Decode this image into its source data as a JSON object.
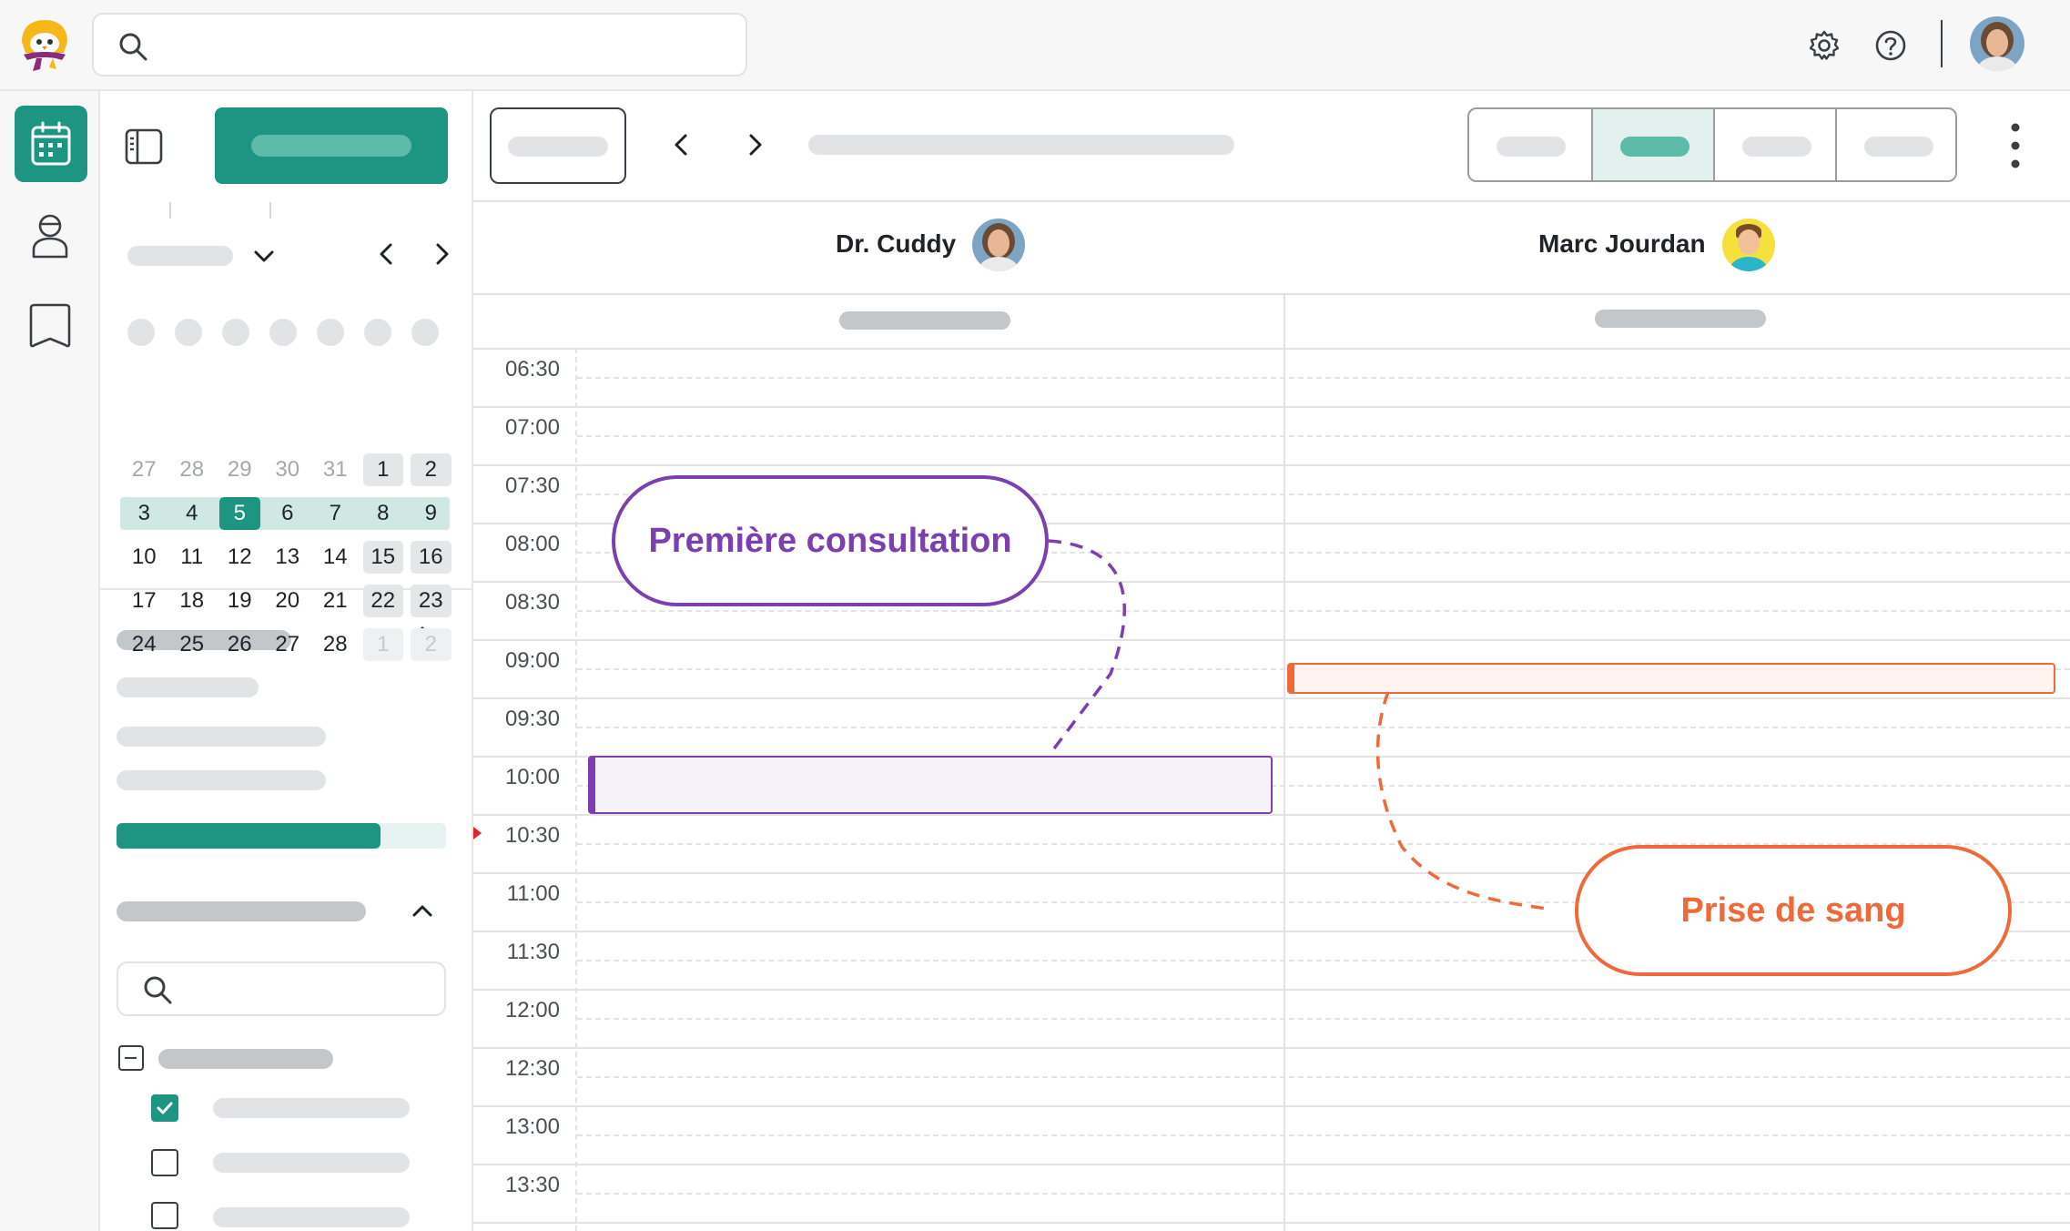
{
  "topbar": {
    "search_icon": "search-icon",
    "settings_icon": "gear-icon",
    "help_icon": "help-icon"
  },
  "rail": {
    "items": [
      {
        "icon": "calendar-icon",
        "active": true
      },
      {
        "icon": "patient-icon",
        "active": false
      },
      {
        "icon": "book-icon",
        "active": false
      }
    ]
  },
  "mini_calendar": {
    "weeks": [
      [
        "27",
        "28",
        "29",
        "30",
        "31",
        "1",
        "2"
      ],
      [
        "3",
        "4",
        "5",
        "6",
        "7",
        "8",
        "9"
      ],
      [
        "10",
        "11",
        "12",
        "13",
        "14",
        "15",
        "16"
      ],
      [
        "17",
        "18",
        "19",
        "20",
        "21",
        "22",
        "23"
      ],
      [
        "24",
        "25",
        "26",
        "27",
        "28",
        "1",
        "2"
      ]
    ],
    "selected_day": "5"
  },
  "practitioners": [
    {
      "name": "Dr. Cuddy"
    },
    {
      "name": "Marc Jourdan"
    }
  ],
  "times": [
    "06:30",
    "07:00",
    "07:30",
    "08:00",
    "08:30",
    "09:00",
    "09:30",
    "10:00",
    "10:30",
    "11:00",
    "11:30",
    "12:00",
    "12:30",
    "13:00",
    "13:30"
  ],
  "events": [
    {
      "label": "Première consultation",
      "color": "#7b3fb0"
    },
    {
      "label": "Prise de sang",
      "color": "#ef6a3a"
    }
  ],
  "colors": {
    "brand": "#1e9582",
    "brand_light": "#cfe8e3",
    "purple": "#7b3fb0",
    "orange": "#ef6a3a"
  }
}
